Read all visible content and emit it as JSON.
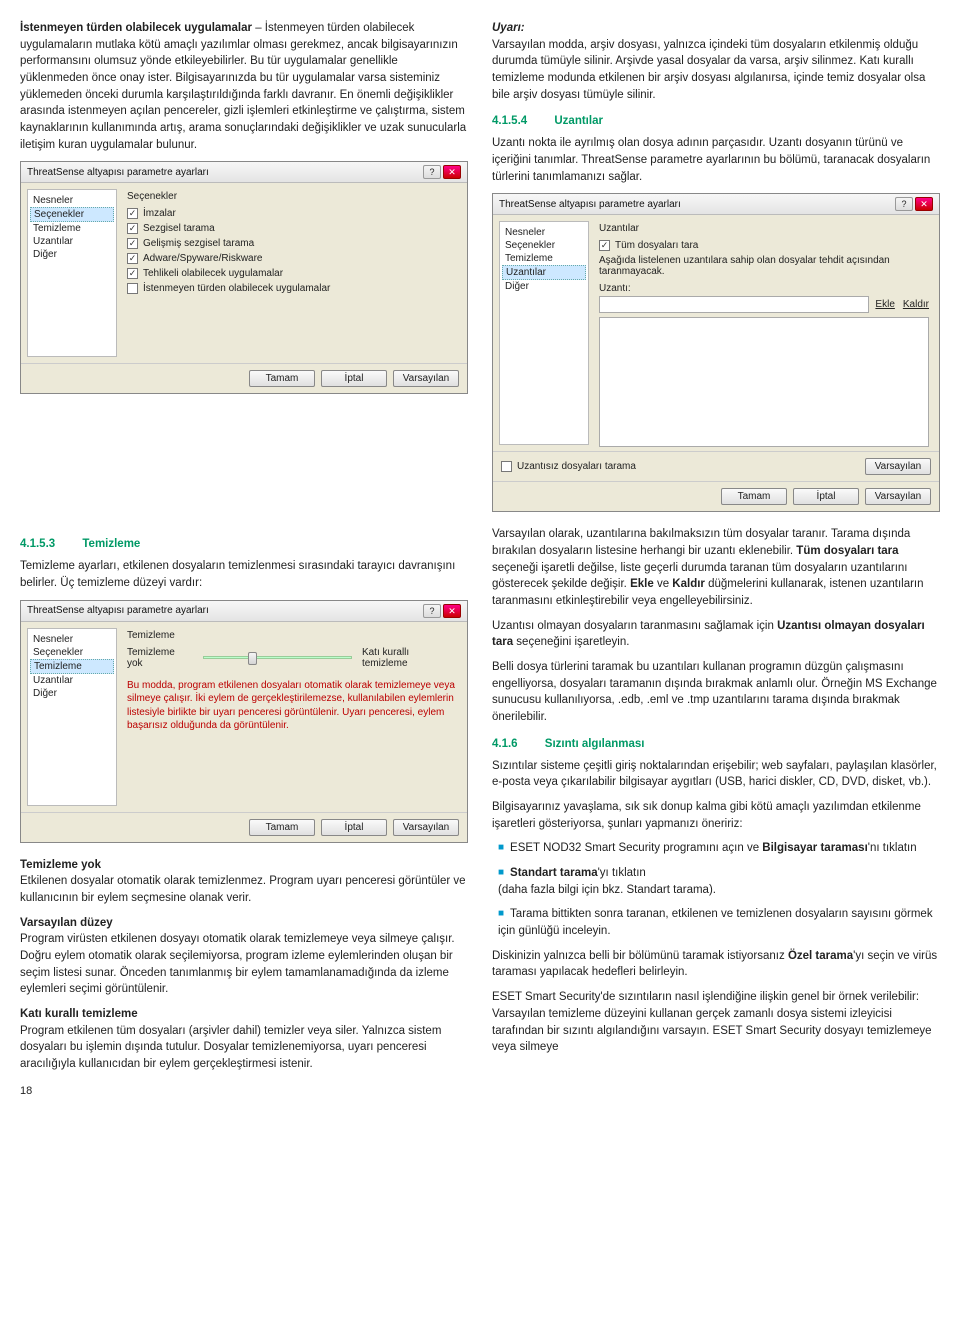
{
  "leftTop": {
    "h": "İstenmeyen türden olabilecek uygulamalar",
    "p": " – İstenmeyen türden olabilecek uygulamaların mutlaka kötü amaçlı yazılımlar olması gerekmez, ancak bilgisayarınızın performansını olumsuz yönde etkileyebilirler. Bu tür uygulamalar genellikle yüklenmeden önce onay ister. Bilgisayarınızda bu tür uygulamalar varsa sisteminiz yüklemeden önceki durumla karşılaştırıldığında farklı davranır. En önemli değişiklikler arasında istenmeyen açılan pencereler, gizli işlemleri etkinleştirme ve çalıştırma, sistem kaynaklarının kullanımında artış, arama sonuçlarındaki değişiklikler ve uzak sunucularla iletişim kuran uygulamalar bulunur."
  },
  "rightTop": {
    "h": "Uyarı:",
    "p": "Varsayılan modda, arşiv dosyası, yalnızca içindeki tüm dosyaların etkilenmiş olduğu durumda tümüyle silinir. Arşivde yasal dosyalar da varsa, arşiv silinmez. Katı kurallı temizleme modunda etkilenen bir arşiv dosyası algılanırsa, içinde temiz dosyalar olsa bile arşiv dosyası tümüyle silinir."
  },
  "sec4154": {
    "num": "4.1.5.4",
    "title": "Uzantılar"
  },
  "uzPara": "Uzantı nokta ile ayrılmış olan dosya adının parçasıdır. Uzantı dosyanın türünü ve içeriğini tanımlar. ThreatSense parametre ayarlarının bu bölümü, taranacak dosyaların türlerini tanımlamanızı sağlar.",
  "dlg1": {
    "title": "ThreatSense altyapısı parametre ayarları",
    "tree": [
      "Nesneler",
      "Seçenekler",
      "Temizleme",
      "Uzantılar",
      "Diğer"
    ],
    "grptitle": "Seçenekler",
    "opts": [
      "İmzalar",
      "Sezgisel tarama",
      "Gelişmiş sezgisel tarama",
      "Adware/Spyware/Riskware",
      "Tehlikeli olabilecek uygulamalar",
      "İstenmeyen türden olabilecek uygulamalar"
    ],
    "checked": [
      true,
      true,
      true,
      true,
      true,
      false
    ],
    "btns": [
      "Tamam",
      "İptal",
      "Varsayılan"
    ]
  },
  "dlg2": {
    "title": "ThreatSense altyapısı parametre ayarları",
    "tree": [
      "Nesneler",
      "Seçenekler",
      "Temizleme",
      "Uzantılar",
      "Diğer"
    ],
    "grptitle": "Uzantılar",
    "scanAll": "Tüm dosyaları tara",
    "note": "Aşağıda listelenen uzantılara sahip olan dosyalar tehdit açısından taranmayacak.",
    "label": "Uzantı:",
    "add": "Ekle",
    "remove": "Kaldır",
    "noext": "Uzantısız dosyaları tarama",
    "btns": [
      "Tamam",
      "İptal",
      "Varsayılan"
    ]
  },
  "sec4153": {
    "num": "4.1.5.3",
    "title": "Temizleme"
  },
  "temizPara": "Temizleme ayarları, etkilenen dosyaların temizlenmesi sırasındaki tarayıcı davranışını belirler. Üç temizleme düzeyi vardır:",
  "dlg3": {
    "title": "ThreatSense altyapısı parametre ayarları",
    "tree": [
      "Nesneler",
      "Seçenekler",
      "Temizleme",
      "Uzantılar",
      "Diğer"
    ],
    "grptitle": "Temizleme",
    "sliderLeft": "Temizleme yok",
    "sliderRight": "Katı kurallı temizleme",
    "note": "Bu modda, program etkilenen dosyaları otomatik olarak temizlemeye veya silmeye çalışır. İki eylem de gerçekleştirilemezse, kullanılabilen eylemlerin listesiyle birlikte bir uyarı penceresi görüntülenir. Uyarı penceresi, eylem başarısız olduğunda da görüntülenir.",
    "btns": [
      "Tamam",
      "İptal",
      "Varsayılan"
    ]
  },
  "temYok": {
    "h": "Temizleme yok",
    "p": "Etkilenen dosyalar otomatik olarak temizlenmez. Program uyarı penceresi görüntüler ve kullanıcının bir eylem seçmesine olanak verir."
  },
  "varsDuz": {
    "h": "Varsayılan düzey",
    "p": "Program virüsten etkilenen dosyayı otomatik olarak temizlemeye veya silmeye çalışır. Doğru eylem otomatik olarak seçilemiyorsa, program izleme eylemlerinden oluşan bir seçim listesi sunar. Önceden tanımlanmış bir eylem tamamlanamadığında da izleme eylemleri seçimi görüntülenir."
  },
  "kati": {
    "h": "Katı kurallı temizleme",
    "p": "Program etkilenen tüm dosyaları (arşivler dahil) temizler veya siler. Yalnızca sistem dosyaları bu işlemin dışında tutulur. Dosyalar temizlenemiyorsa, uyarı penceresi aracılığıyla kullanıcıdan bir eylem gerçekleştirmesi istenir."
  },
  "pageNum": "18",
  "r1": {
    "p1a": "Varsayılan olarak, uzantılarına bakılmaksızın tüm dosyalar taranır. Tarama dışında bırakılan dosyaların listesine herhangi bir uzantı eklenebilir. ",
    "b1": "Tüm dosyaları tara",
    "p1b": " seçeneği işaretli değilse, liste geçerli durumda taranan tüm dosyaların uzantılarını gösterecek şekilde değişir. ",
    "b2": "Ekle",
    "p1c": " ve ",
    "b3": "Kaldır",
    "p1d": " düğmelerini kullanarak, istenen uzantıların taranmasını etkinleştirebilir veya engelleyebilirsiniz."
  },
  "r2": {
    "p1": "Uzantısı olmayan dosyaların taranmasını sağlamak için ",
    "b1": "Uzantısı olmayan dosyaları tara",
    "p2": " seçeneğini işaretleyin."
  },
  "r3": "Belli dosya türlerini taramak bu uzantıları kullanan programın düzgün çalışmasını engelliyorsa, dosyaları taramanın dışında bırakmak anlamlı olur. Örneğin MS Exchange sunucusu kullanılıyorsa, .edb, .eml ve .tmp uzantılarını tarama dışında bırakmak önerilebilir.",
  "sec416": {
    "num": "4.1.6",
    "title": "Sızıntı algılanması"
  },
  "siz1": "Sızıntılar sisteme çeşitli giriş noktalarından erişebilir; web sayfaları, paylaşılan klasörler, e-posta veya çıkarılabilir bilgisayar aygıtları (USB, harici diskler, CD, DVD, disket, vb.).",
  "siz2": "Bilgisayarınız yavaşlama, sık sık donup kalma gibi kötü amaçlı yazılımdan etkilenme işaretleri gösteriyorsa, şunları yapmanızı öneririz:",
  "bullets": {
    "b1a": "ESET NOD32 Smart Security programını açın ve ",
    "b1b": "Bilgisayar taraması",
    "b1c": "'nı tıklatın",
    "b2a": "Standart tarama",
    "b2b": "'yı tıklatın",
    "b2c": "(daha fazla bilgi için bkz. Standart tarama).",
    "b3": "Tarama bittikten sonra taranan, etkilenen ve temizlenen dosyaların sayısını görmek için günlüğü inceleyin."
  },
  "disk": {
    "p1": "Diskinizin yalnızca belli bir bölümünü taramak istiyorsanız ",
    "b": "Özel tarama",
    "p2": "'yı seçin ve virüs taraması yapılacak hedefleri belirleyin."
  },
  "last": "ESET Smart Security'de sızıntıların nasıl işlendiğine ilişkin genel bir örnek verilebilir: Varsayılan temizleme düzeyini kullanan gerçek zamanlı dosya sistemi izleyicisi tarafından bir sızıntı algılandığını varsayın. ESET Smart Security dosyayı temizlemeye veya silmeye"
}
